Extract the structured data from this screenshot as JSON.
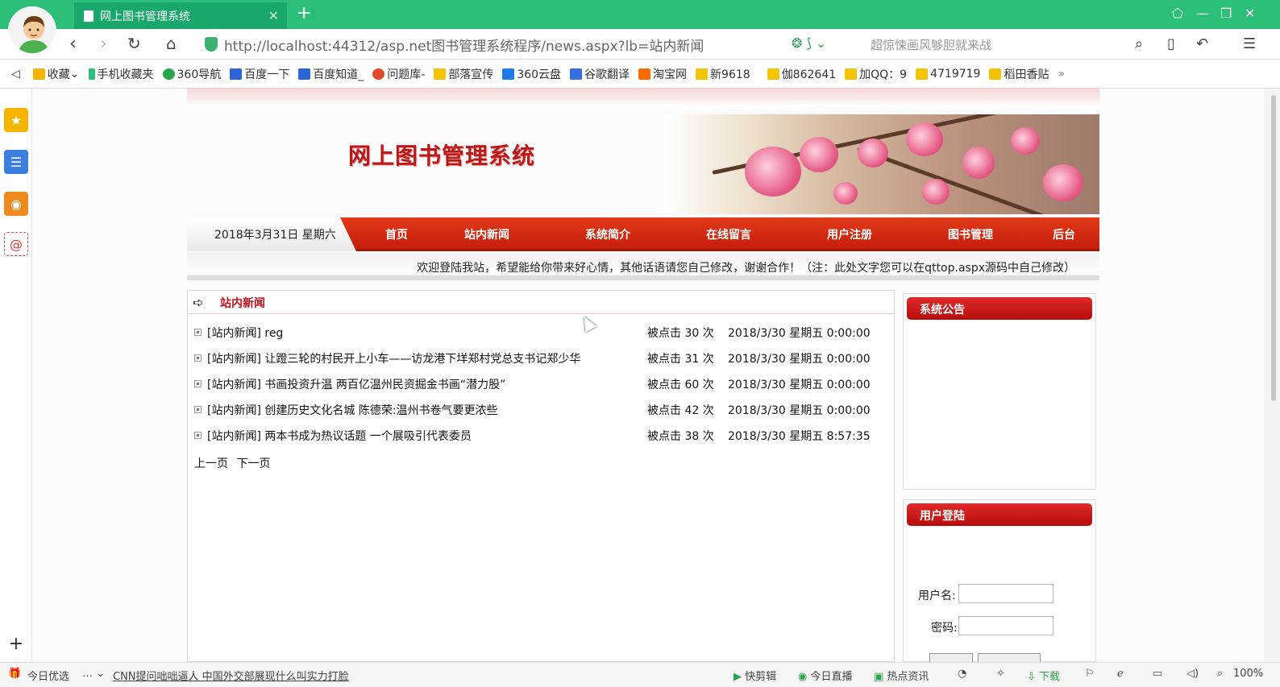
{
  "browser": {
    "tab_title": "网上图书管理系统",
    "new_tab": "+",
    "url": "http://localhost:44312/asp.net图书管理系统程序/news.aspx?lb=站内新闻",
    "search_suggestion": "超惊悚画风够胆就来战",
    "accent_color": "#2bbf7a"
  },
  "bookmarks": [
    {
      "label": "收藏",
      "icon": "star-icon"
    },
    {
      "label": "手机收藏夹",
      "icon": "phone-icon"
    },
    {
      "label": "360导航",
      "icon": "plus-circle-icon"
    },
    {
      "label": "百度一下",
      "icon": "paw-icon"
    },
    {
      "label": "百度知道_",
      "icon": "paw-icon"
    },
    {
      "label": "问题库-",
      "icon": "s-logo-icon"
    },
    {
      "label": "部落宣传",
      "icon": "folder-icon"
    },
    {
      "label": "360云盘",
      "icon": "cloud-icon"
    },
    {
      "label": "谷歌翻译",
      "icon": "translate-icon"
    },
    {
      "label": "淘宝网",
      "icon": "taobao-icon"
    },
    {
      "label": "新9618",
      "icon": "folder-icon"
    },
    {
      "label": "伽862641",
      "icon": "folder-icon"
    },
    {
      "label": "加QQ：9",
      "icon": "folder-icon"
    },
    {
      "label": "4719719",
      "icon": "folder-icon"
    },
    {
      "label": "稻田香贴",
      "icon": "folder-icon"
    }
  ],
  "site": {
    "title": "网上图书管理系统",
    "date": "2018年3月31日 星期六",
    "nav": [
      "首页",
      "站内新闻",
      "系统简介",
      "在线留言",
      "用户注册",
      "图书管理",
      "后台"
    ],
    "welcome": "欢迎登陆我站，希望能给你带来好心情，其他话语请您自己修改，谢谢合作！（注：此处文字您可以在qttop.aspx源码中自己修改）",
    "news_section_title": "站内新闻",
    "news": [
      {
        "title": "[站内新闻] reg",
        "hits": "被点击 30 次",
        "date": "2018/3/30 星期五 0:00:00"
      },
      {
        "title": "[站内新闻] 让蹬三轮的村民开上小车——访龙港下垟郑村党总支书记郑少华",
        "hits": "被点击 31 次",
        "date": "2018/3/30 星期五 0:00:00"
      },
      {
        "title": "[站内新闻] 书画投资升温 两百亿温州民资掘金书画“潜力股”",
        "hits": "被点击 60 次",
        "date": "2018/3/30 星期五 0:00:00"
      },
      {
        "title": "[站内新闻] 创建历史文化名城 陈德荣:温州书卷气要更浓些",
        "hits": "被点击 42 次",
        "date": "2018/3/30 星期五 0:00:00"
      },
      {
        "title": "[站内新闻] 两本书成为热议话题 一个展吸引代表委员",
        "hits": "被点击 38 次",
        "date": "2018/3/30 星期五 8:57:35"
      }
    ],
    "pager_prev": "上一页",
    "pager_next": "下一页",
    "notice_title": "系统公告",
    "login_title": "用户登陆",
    "username_label": "用户名:",
    "password_label": "密码:"
  },
  "statusbar": {
    "today_pick": "今日优选",
    "headline": "CNN提问咄咄逼人 中国外交部展现什么叫实力打脸",
    "items": [
      "快剪辑",
      "今日直播",
      "热点资讯",
      "下载"
    ],
    "zoom": "100%"
  }
}
